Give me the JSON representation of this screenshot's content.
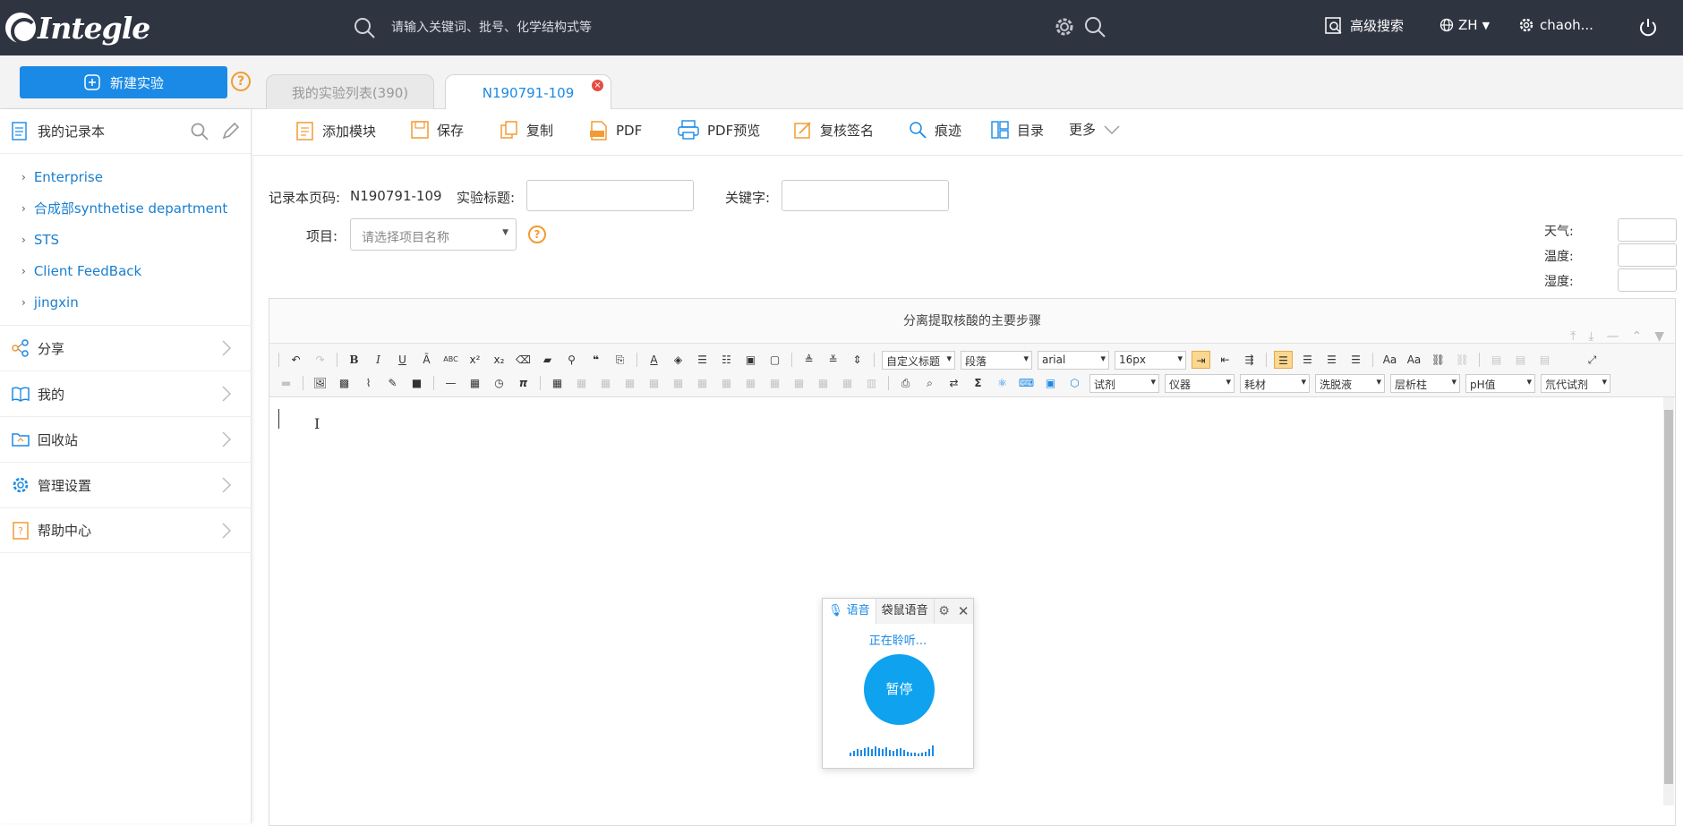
{
  "header": {
    "logo_text": "Integle",
    "search_placeholder": "请输入关键词、批号、化学结构式等",
    "advanced_search": "高级搜索",
    "language": "ZH",
    "username": "chaoh..."
  },
  "subbar": {
    "new_experiment": "新建实验",
    "help": "?",
    "tabs": [
      {
        "label": "我的实验列表(390)",
        "active": false
      },
      {
        "label": "N190791-109",
        "active": true
      }
    ],
    "tab_close": "×"
  },
  "sidebar": {
    "notebook_title": "我的记录本",
    "notebooks": [
      {
        "label": "Enterprise"
      },
      {
        "label": "合成部synthetise department"
      },
      {
        "label": "STS"
      },
      {
        "label": "Client FeedBack"
      },
      {
        "label": "jingxin"
      }
    ],
    "sections": [
      {
        "label": "分享",
        "icon": "share-icon"
      },
      {
        "label": "我的",
        "icon": "book-icon"
      },
      {
        "label": "回收站",
        "icon": "recycle-folder-icon"
      },
      {
        "label": "管理设置",
        "icon": "gear-icon"
      },
      {
        "label": "帮助中心",
        "icon": "help-doc-icon"
      }
    ]
  },
  "toolbar": {
    "buttons": [
      {
        "label": "添加模块",
        "icon": "add-module-icon"
      },
      {
        "label": "保存",
        "icon": "save-icon"
      },
      {
        "label": "复制",
        "icon": "copy-icon"
      },
      {
        "label": "PDF",
        "icon": "pdf-icon"
      },
      {
        "label": "PDF预览",
        "icon": "printer-icon"
      },
      {
        "label": "复核签名",
        "icon": "sign-icon"
      },
      {
        "label": "痕迹",
        "icon": "trace-icon"
      },
      {
        "label": "目录",
        "icon": "catalog-icon"
      },
      {
        "label": "更多",
        "icon": "chevron-down-icon"
      }
    ]
  },
  "form": {
    "page_code_label": "记录本页码:",
    "page_code_value": "N190791-109",
    "title_label": "实验标题:",
    "title_value": "",
    "keyword_label": "关键字:",
    "keyword_value": "",
    "project_label": "项目:",
    "project_placeholder": "请选择项目名称",
    "weather_label": "天气:",
    "temperature_label": "温度:",
    "humidity_label": "湿度:"
  },
  "editor": {
    "module_title": "分离提取核酸的主要步骤",
    "dropdowns_row1": [
      "自定义标题",
      "段落",
      "arial",
      "16px"
    ],
    "dropdowns_row2": [
      "试剂",
      "仪器",
      "耗材",
      "洗脱液",
      "层析柱",
      "pH值",
      "氘代试剂"
    ]
  },
  "voice": {
    "tab_voice": "语音",
    "tab_mouse": "袋鼠语音",
    "status": "正在聆听...",
    "pause": "暂停"
  },
  "colors": {
    "topbar": "#2f3441",
    "accent_blue": "#1a8ae6",
    "help_orange": "#f29b33"
  }
}
